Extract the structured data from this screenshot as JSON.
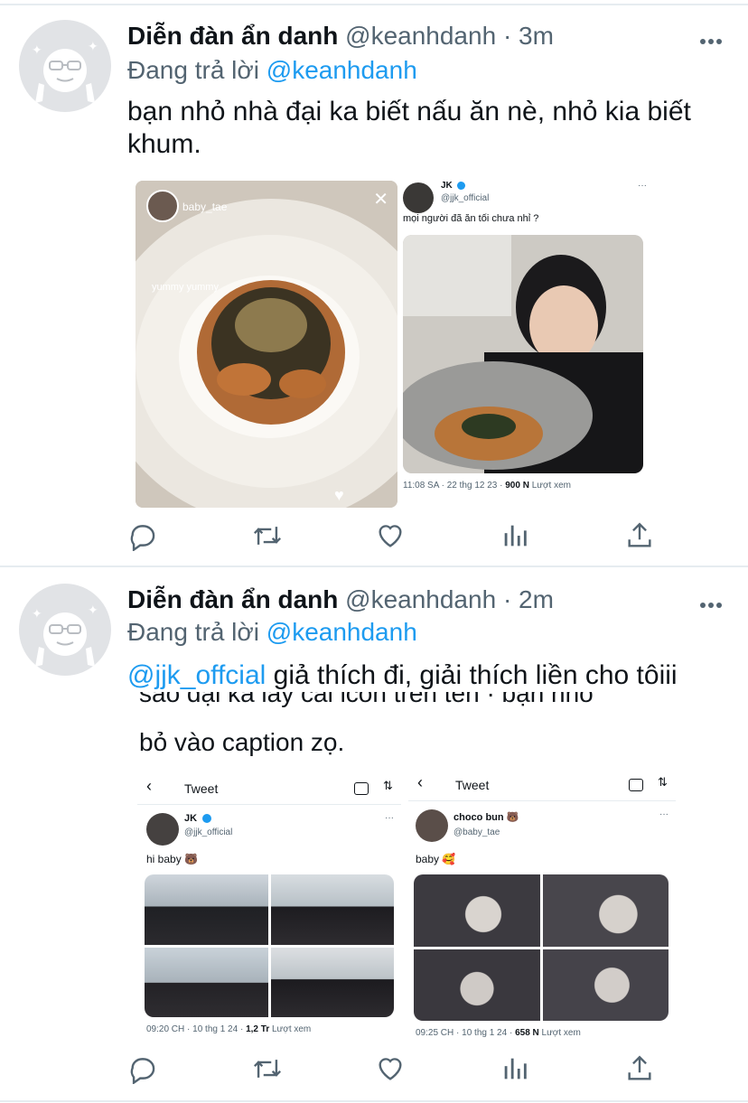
{
  "tweets": [
    {
      "name": "Diễn đàn ẩn danh",
      "handle": "@keanhdanh",
      "time": "· 3m",
      "reply_prefix": "Đang trả lời",
      "reply_to": "@keanhdanh",
      "text": "bạn nhỏ nhà đại ka biết nấu ăn nè, nhỏ kia biết khum.",
      "image": {
        "left": {
          "username": "baby_tae",
          "caption": "yummy yummy"
        },
        "right": {
          "name": "JK",
          "handle": "@jjk_official",
          "text": "mọi người đã ăn tối chưa nhỉ ?",
          "meta_prefix": "11:08 SA · 22 thg 12 23 ·",
          "views": "900 N",
          "views_label": "Lượt xem"
        }
      }
    },
    {
      "name": "Diễn đàn ẩn danh",
      "handle": "@keanhdanh",
      "time": "· 2m",
      "reply_prefix": "Đang trả lời",
      "reply_to": "@keanhdanh",
      "mention": "@jjk_offcial",
      "text": "giả thích đi, giải thích liền cho tôiii",
      "overlay_text_line1": "sao đại ka lấy cái icon trên tên · bạn nhỏ",
      "overlay_text_line2": "bỏ vào caption zọ.",
      "image": {
        "left": {
          "nav_title": "Tweet",
          "name": "JK",
          "handle": "@jjk_official",
          "text": "hi baby 🐻",
          "meta_prefix": "09:20 CH · 10 thg 1 24 ·",
          "views": "1,2 Tr",
          "views_label": "Lượt xem"
        },
        "right": {
          "nav_title": "Tweet",
          "name": "choco bun 🐻",
          "handle": "@baby_tae",
          "text": "baby 🥰",
          "meta_prefix": "09:25 CH · 10 thg 1 24 ·",
          "views": "658 N",
          "views_label": "Lượt xem"
        }
      }
    }
  ],
  "colors": {
    "accent": "#1d9bf0",
    "secondary": "#536471",
    "divider": "#e6ecf0"
  },
  "icons": [
    "more-icon",
    "reply-icon",
    "retweet-icon",
    "like-icon",
    "analytics-icon",
    "share-icon",
    "back-arrow-icon",
    "camera-icon",
    "sort-icon",
    "verified-icon",
    "close-icon"
  ]
}
